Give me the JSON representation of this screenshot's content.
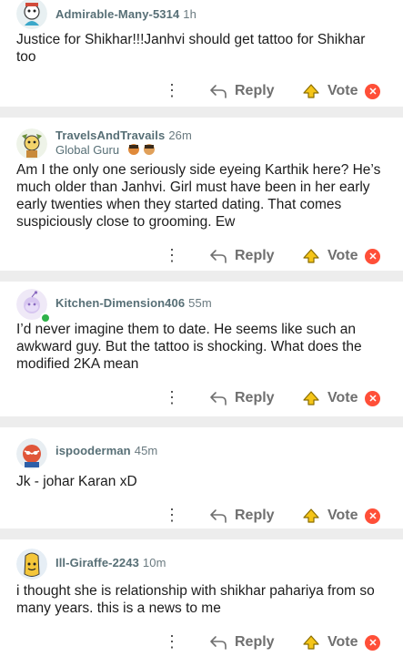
{
  "comments": [
    {
      "username": "Admirable-Many-5314",
      "time": "1h",
      "flair": "",
      "body": "Justice for Shikhar!!!Janhvi should get tattoo for Shikhar too",
      "reply_label": "Reply",
      "vote_label": "Vote"
    },
    {
      "username": "TravelsAndTravails",
      "time": "26m",
      "flair": "Global Guru",
      "body": "Am I the only one seriously side eyeing Karthik here? He’s much older than Janhvi. Girl must have been in her early early twenties when they started dating. That comes suspiciously close to grooming. Ew",
      "reply_label": "Reply",
      "vote_label": "Vote"
    },
    {
      "username": "Kitchen-Dimension406",
      "time": "55m",
      "flair": "",
      "body": "I’d never imagine them to date. He seems like such an awkward guy. But the tattoo is shocking. What does the modified 2KA mean",
      "reply_label": "Reply",
      "vote_label": "Vote"
    },
    {
      "username": "ispooderman",
      "time": "45m",
      "flair": "",
      "body": "Jk - johar Karan xD",
      "reply_label": "Reply",
      "vote_label": "Vote"
    },
    {
      "username": "Ill-Giraffe-2243",
      "time": "10m",
      "flair": "",
      "body": "i thought she is relationship with shikhar pahariya from so many years. this is a news to me",
      "reply_label": "Reply",
      "vote_label": "Vote"
    }
  ],
  "icons": {
    "more": "more-options-icon",
    "reply": "reply-arrow-icon",
    "upvote": "upvote-arrow-icon",
    "downvote": "downvote-icon"
  },
  "colors": {
    "username": "#576f76",
    "action_text": "#6f6f6f",
    "upvote_fill": "#f5c518",
    "downvote_fill": "#ff4f38",
    "separator": "#ededed"
  }
}
